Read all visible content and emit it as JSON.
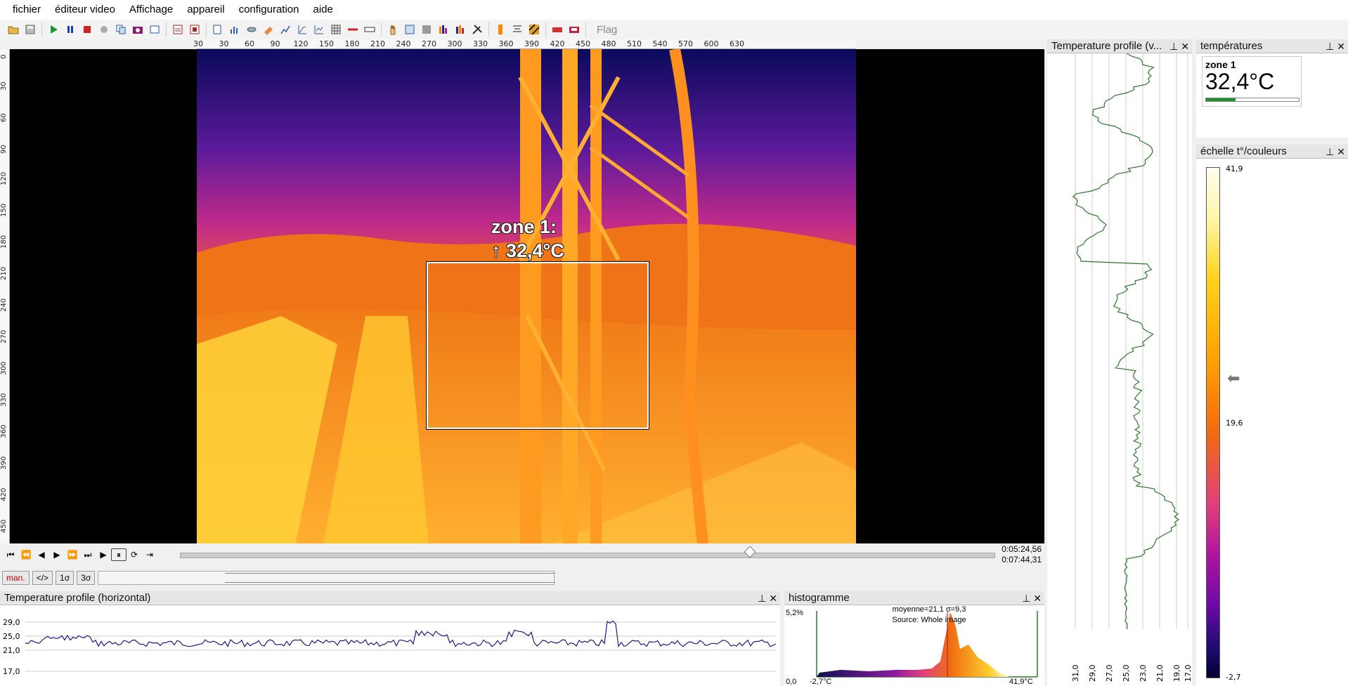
{
  "menu": [
    "fichier",
    "éditeur video",
    "Affichage",
    "appareil",
    "configuration",
    "aide"
  ],
  "toolbar": {
    "flag_label": "Flag"
  },
  "ruler": {
    "top": [
      "30",
      "30",
      "60",
      "90",
      "120",
      "150",
      "180",
      "210",
      "240",
      "270",
      "300",
      "330",
      "360",
      "390",
      "420",
      "450",
      "480",
      "510",
      "540",
      "570",
      "600",
      "630"
    ],
    "left": [
      "0",
      "30",
      "60",
      "90",
      "120",
      "150",
      "180",
      "210",
      "240",
      "270",
      "300",
      "330",
      "360",
      "390",
      "420",
      "450"
    ]
  },
  "zone_overlay": {
    "line1": "zone 1:",
    "line2": "↑ 32,4°C"
  },
  "transport": {
    "time_current": "0:05:24,56",
    "time_total": "0:07:44,31",
    "progress": 0.699
  },
  "modes": [
    "man.",
    "</>",
    "1σ",
    "3σ"
  ],
  "panels": {
    "hprofile": {
      "title": "Temperature profile (horizontal)",
      "yticks": [
        "29,0",
        "25,0",
        "21,0",
        "17,0"
      ]
    },
    "histogram": {
      "title": "histogramme",
      "stats": "moyenne=21,1 σ=9,3",
      "source": "Source:  Whole image",
      "ymax": "5,2%",
      "ymin": "0,0",
      "xmin": "-2,7°C",
      "xmax": "41,9°C"
    },
    "vprofile": {
      "title": "Temperature profile (v...",
      "xticks": [
        "31,0",
        "29,0",
        "27,0",
        "25,0",
        "23,0",
        "21,0",
        "19,0",
        "17,0"
      ]
    },
    "temperatures": {
      "title": "températures",
      "zone_name": "zone 1",
      "zone_value": "32,4°C"
    },
    "scale": {
      "title": "échelle t°/couleurs",
      "max": "41,9",
      "mid": "19,6",
      "min": "-2,7"
    }
  },
  "colors": {
    "thermal_orange": "#f07a18",
    "thermal_yellow": "#ffd23a",
    "sky_purple": "#7a1aa8",
    "profile_green": "#2a7a2a",
    "profile_blue": "#1a1a8a"
  }
}
